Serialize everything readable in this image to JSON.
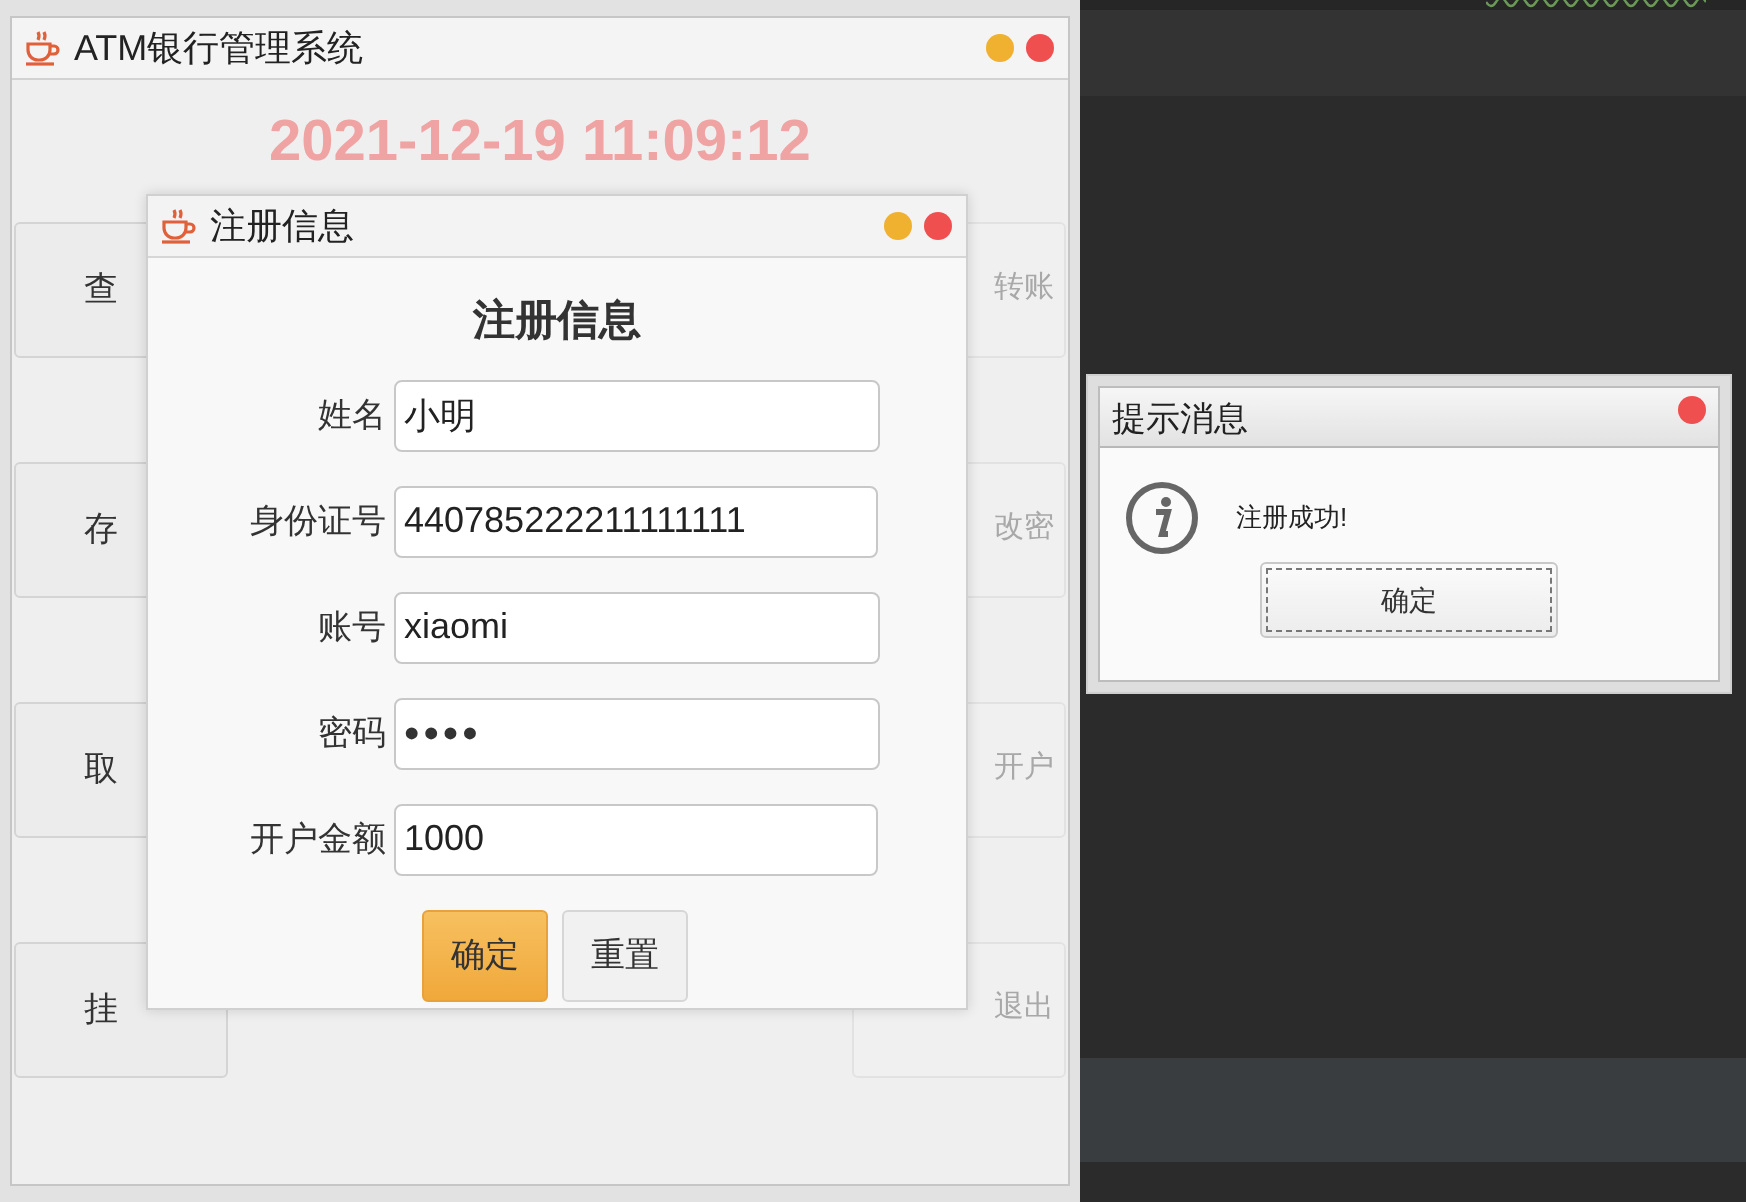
{
  "main_window": {
    "title": "ATM银行管理系统",
    "clock": "2021-12-19 11:09:12",
    "left_buttons": [
      "查",
      "存",
      "取",
      "挂"
    ],
    "right_buttons": [
      "转账",
      "改密",
      "开户",
      "退出"
    ]
  },
  "register_dialog": {
    "title": "注册信息",
    "heading": "注册信息",
    "fields": [
      {
        "label": "姓名",
        "value": "小明",
        "kind": "text"
      },
      {
        "label": "身份证号",
        "value": "440785222211111111",
        "kind": "text"
      },
      {
        "label": "账号",
        "value": "xiaomi",
        "kind": "text"
      },
      {
        "label": "密码",
        "value": "••••",
        "kind": "password"
      },
      {
        "label": "开户金额",
        "value": "1000",
        "kind": "text"
      }
    ],
    "buttons": [
      {
        "label": "确定",
        "kind": "primary"
      },
      {
        "label": "重置",
        "kind": "default"
      }
    ]
  },
  "message_dialog": {
    "title": "提示消息",
    "message": "注册成功!",
    "button": "确定"
  }
}
